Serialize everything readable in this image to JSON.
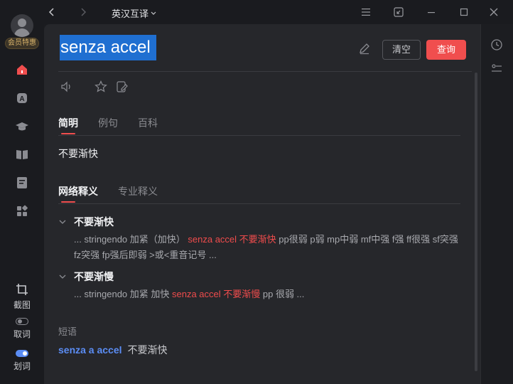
{
  "sidebar": {
    "vip_label": "会员特惠",
    "tools": [
      {
        "label": "截图"
      },
      {
        "label": "取词"
      },
      {
        "label": "划词"
      }
    ]
  },
  "topbar": {
    "mode_label": "英汉互译"
  },
  "query": {
    "text": "senza accel",
    "clear_label": "清空",
    "search_label": "查询"
  },
  "tabs_primary": [
    {
      "label": "简明",
      "active": true
    },
    {
      "label": "例句",
      "active": false
    },
    {
      "label": "百科",
      "active": false
    }
  ],
  "brief_translation": "不要渐快",
  "tabs_secondary": [
    {
      "label": "网络释义",
      "active": true
    },
    {
      "label": "专业释义",
      "active": false
    }
  ],
  "senses": [
    {
      "title": "不要渐快",
      "pre": "... stringendo 加紧（加快） ",
      "highlight": "senza accel 不要渐快",
      "post": " pp很弱 p弱 mp中弱 mf中强 f强 ff很强 sf突强 fz突强 fp强后即弱 >或<重音记号 ..."
    },
    {
      "title": "不要渐慢",
      "pre": "... stringendo 加紧 加快 ",
      "highlight": "senza accel 不要渐慢",
      "post": " pp 很弱 ..."
    }
  ],
  "phrases": {
    "label": "短语",
    "items": [
      {
        "en": "senza a accel",
        "zh": "不要渐快"
      }
    ]
  },
  "colors": {
    "accent": "#f04e4e",
    "selection": "#1f6fd1",
    "link": "#5b8df5"
  }
}
